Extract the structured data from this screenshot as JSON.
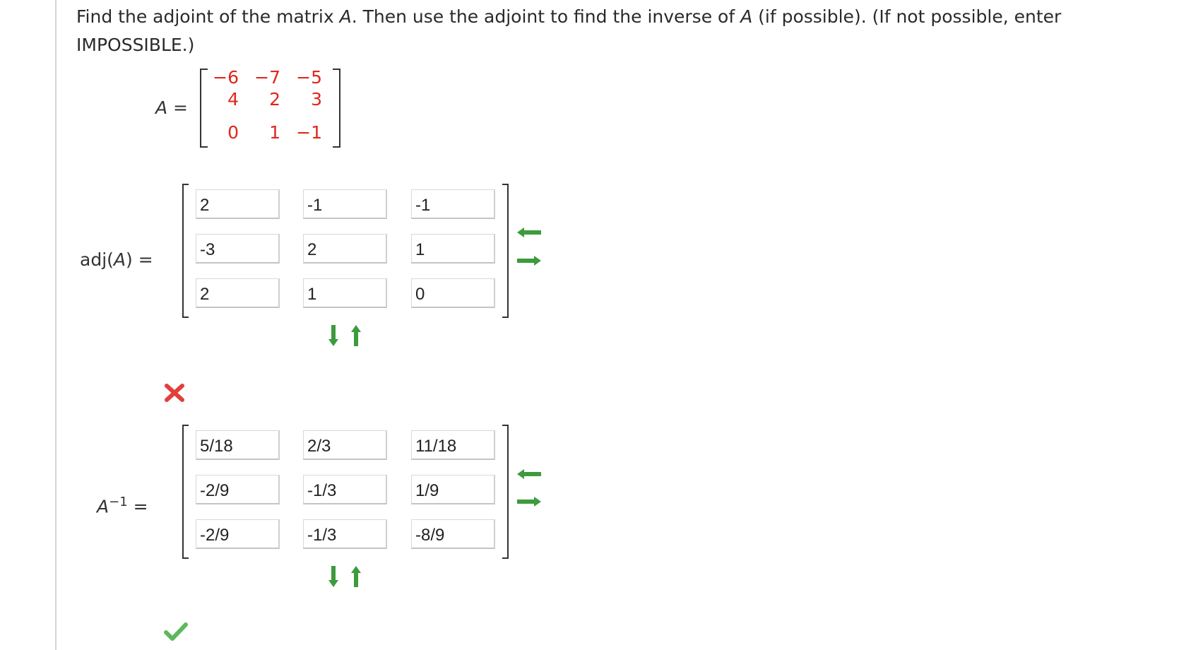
{
  "question": {
    "part1": "Find the adjoint of the matrix ",
    "var1": "A",
    "part2": ". Then use the adjoint to find the inverse of ",
    "var2": "A",
    "part3": " (if possible). (If not possible, enter",
    "part4": "IMPOSSIBLE.)"
  },
  "matrix_a": {
    "label_var": "A",
    "label_eq": " =",
    "rows": [
      [
        "−6",
        "−7",
        "−5"
      ],
      [
        "4",
        "2",
        "3"
      ],
      [
        "0",
        "1",
        "−1"
      ]
    ]
  },
  "adj": {
    "label_prefix": "adj(",
    "label_var": "A",
    "label_suffix": ")",
    "label_eq": "=",
    "values": [
      [
        "2",
        "-1",
        "-1"
      ],
      [
        "-3",
        "2",
        "1"
      ],
      [
        "2",
        "1",
        "0"
      ]
    ],
    "status": "incorrect",
    "status_icon": "x-mark-icon",
    "status_color": "#e2403a"
  },
  "inverse": {
    "label_var": "A",
    "label_exp": "−1",
    "label_eq": "=",
    "values": [
      [
        "5/18",
        "2/3",
        "11/18"
      ],
      [
        "-2/9",
        "-1/3",
        "1/9"
      ],
      [
        "-2/9",
        "-1/3",
        "-8/9"
      ]
    ],
    "status": "correct",
    "status_icon": "check-mark-icon",
    "status_color": "#5cb85c"
  },
  "arrow_color": "#3d9a3d"
}
